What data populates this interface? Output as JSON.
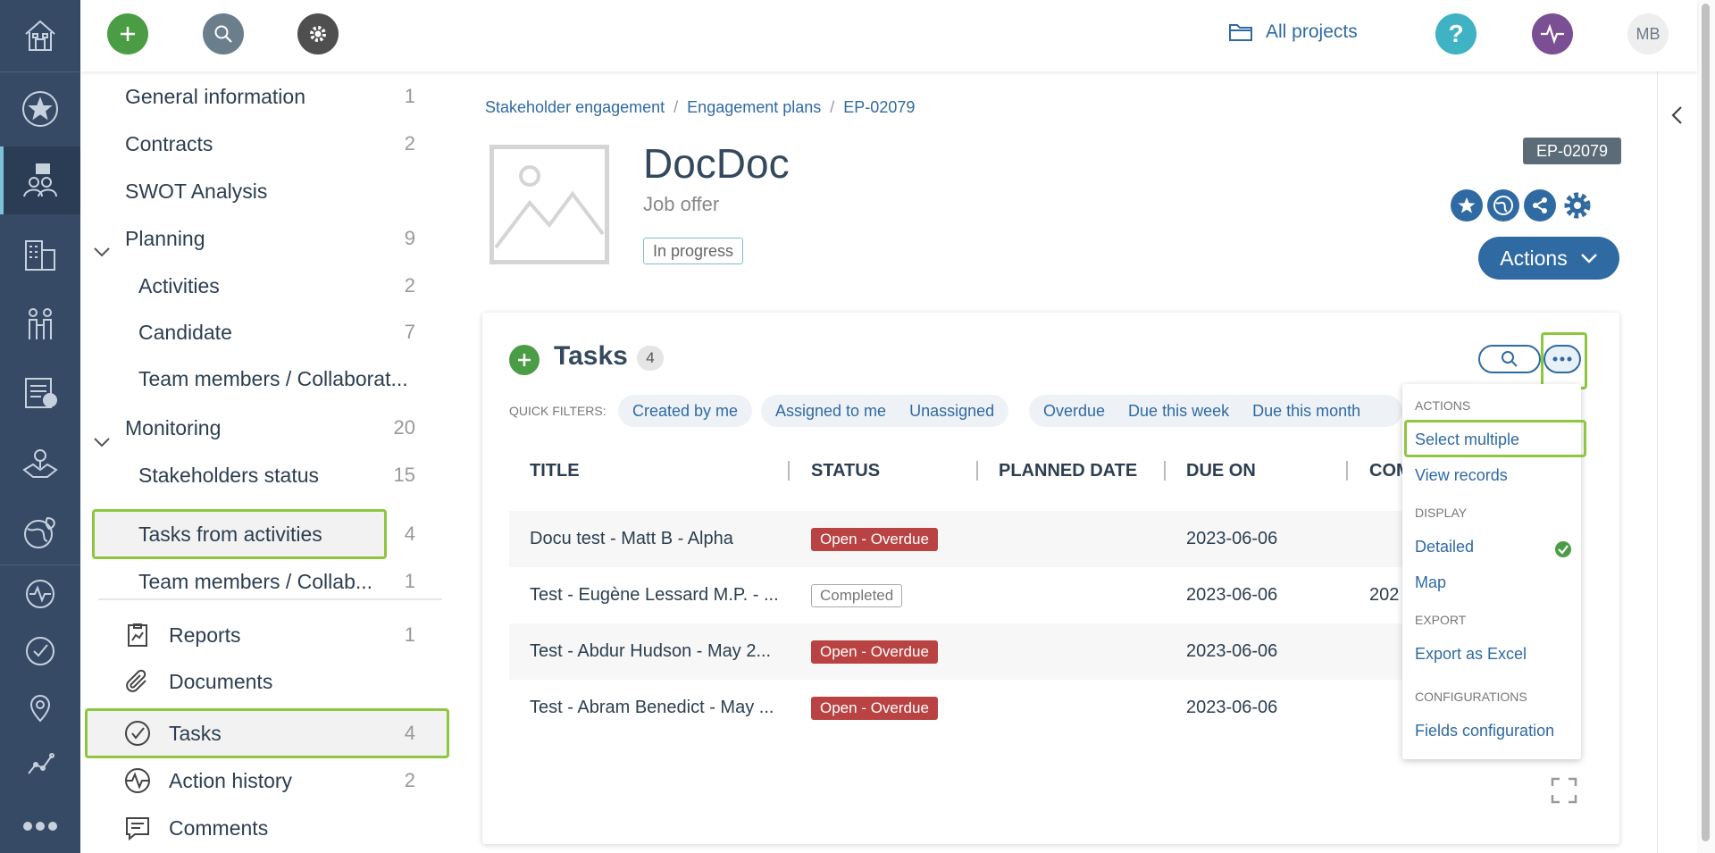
{
  "rail": {
    "items": [
      "home-icon",
      "star-icon",
      "stakeholders-icon",
      "buildings-icon",
      "people-icon",
      "checklist-icon",
      "map-icon",
      "globe-leaf-icon",
      "activity-icon",
      "check-circle-icon",
      "location-icon",
      "graph-icon",
      "more-icon"
    ]
  },
  "topbar": {
    "all_projects": "All projects",
    "help": "?",
    "avatar": "MB",
    "accent": "#4a9d44"
  },
  "nav": {
    "items": [
      {
        "label": "General information",
        "count": "1"
      },
      {
        "label": "Contracts",
        "count": "2"
      },
      {
        "label": "SWOT Analysis",
        "count": ""
      },
      {
        "label": "Planning",
        "count": "9"
      },
      {
        "label": "Activities",
        "count": "2"
      },
      {
        "label": "Candidate",
        "count": "7"
      },
      {
        "label": "Team members / Collaborat...",
        "count": ""
      },
      {
        "label": "Monitoring",
        "count": "20"
      },
      {
        "label": "Stakeholders status",
        "count": "15"
      },
      {
        "label": "Tasks from activities",
        "count": "4"
      },
      {
        "label": "Team members / Collab...",
        "count": "1"
      },
      {
        "label": "Reports",
        "count": "1"
      },
      {
        "label": "Documents",
        "count": ""
      },
      {
        "label": "Tasks",
        "count": "4"
      },
      {
        "label": "Action history",
        "count": "2"
      },
      {
        "label": "Comments",
        "count": ""
      }
    ]
  },
  "breadcrumb": [
    "Stakeholder engagement",
    "Engagement plans",
    "EP-02079"
  ],
  "header": {
    "title": "DocDoc",
    "subtitle": "Job offer",
    "status": "In progress",
    "id_badge": "EP-02079",
    "actions_label": "Actions"
  },
  "tasks": {
    "title": "Tasks",
    "count": "4",
    "quick_filters_label": "QUICK FILTERS:",
    "filters_group1": [
      "Created by me"
    ],
    "filters_group2": [
      "Assigned to me",
      "Unassigned"
    ],
    "filters_group3": [
      "Overdue",
      "Due this week",
      "Due this month"
    ],
    "columns": [
      "TITLE",
      "STATUS",
      "PLANNED DATE",
      "DUE ON",
      "COM"
    ],
    "rows": [
      {
        "title": "Docu test - Matt B - Alpha",
        "status": "Open - Overdue",
        "due": "2023-06-06",
        "completed": ""
      },
      {
        "title": "Test - Eugène Lessard M.P. - ...",
        "status": "Completed",
        "due": "2023-06-06",
        "completed": "202"
      },
      {
        "title": "Test - Abdur Hudson - May 2...",
        "status": "Open - Overdue",
        "due": "2023-06-06",
        "completed": ""
      },
      {
        "title": "Test - Abram Benedict - May ...",
        "status": "Open - Overdue",
        "due": "2023-06-06",
        "completed": ""
      }
    ]
  },
  "menu": {
    "actions_head": "ACTIONS",
    "select_multiple": "Select multiple",
    "view_records": "View records",
    "display_head": "DISPLAY",
    "detailed": "Detailed",
    "map": "Map",
    "export_head": "EXPORT",
    "export_excel": "Export as Excel",
    "config_head": "CONFIGURATIONS",
    "fields_config": "Fields configuration"
  }
}
